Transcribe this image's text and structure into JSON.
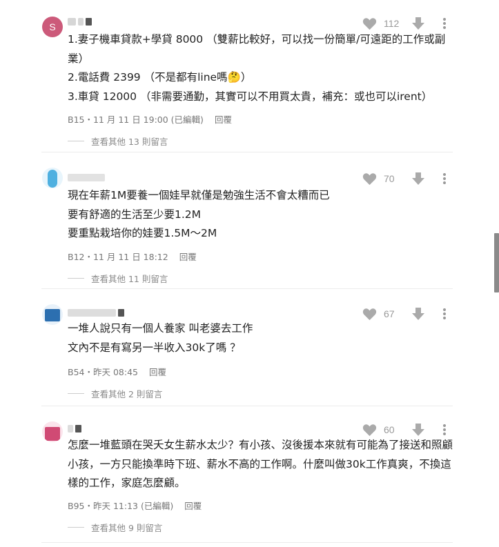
{
  "comments": [
    {
      "avatar_letter": "S",
      "avatar_color": "#cc5a7a",
      "likes": "112",
      "lines": [
        "1.妻子機車貸款+學貸 8000 （雙薪比較好，可以找一份簡單/可遠距的工作或副業）",
        "2.電話費 2399 （不是都有line嗎🤔）",
        "3.車貸 12000 （非需要通勤，其實可以不用買太貴，補充：或也可以irent）"
      ],
      "meta": "B15・11 月 11 日 19:00 (已編輯)",
      "reply_label": "回覆",
      "more_replies": "查看其他 13 則留言"
    },
    {
      "avatar_color": "#4fb0e0",
      "likes": "70",
      "lines": [
        "現在年薪1M要養一個娃早就僅是勉強生活不會太糟而已",
        "要有舒適的生活至少要1.2M",
        "要重點栽培你的娃要1.5M～2M"
      ],
      "meta": "B12・11 月 11 日 18:12",
      "reply_label": "回覆",
      "more_replies": "查看其他 11 則留言"
    },
    {
      "avatar_color": "#2c6fb0",
      "likes": "67",
      "lines": [
        "一堆人說只有一個人養家 叫老婆去工作",
        "文內不是有寫另一半收入30k了嗎 ？"
      ],
      "meta": "B54・昨天 08:45",
      "reply_label": "回覆",
      "more_replies": "查看其他 2 則留言"
    },
    {
      "avatar_color": "#d04a74",
      "likes": "60",
      "lines": [
        "怎麼一堆藍頭在哭夭女生薪水太少？有小孩、沒後援本來就有可能為了接送和照顧小孩，一方只能換準時下班、薪水不高的工作啊。什麼叫做30k工作真爽，不換這樣的工作，家庭怎麼顧。"
      ],
      "meta": "B95・昨天 11:13 (已編輯)",
      "reply_label": "回覆",
      "more_replies": "查看其他 9 則留言"
    }
  ],
  "icons": {
    "like": "heart-icon",
    "downvote": "arrow-down-icon",
    "menu": "more-vertical-icon",
    "icon_color": "#aaaaaa"
  }
}
